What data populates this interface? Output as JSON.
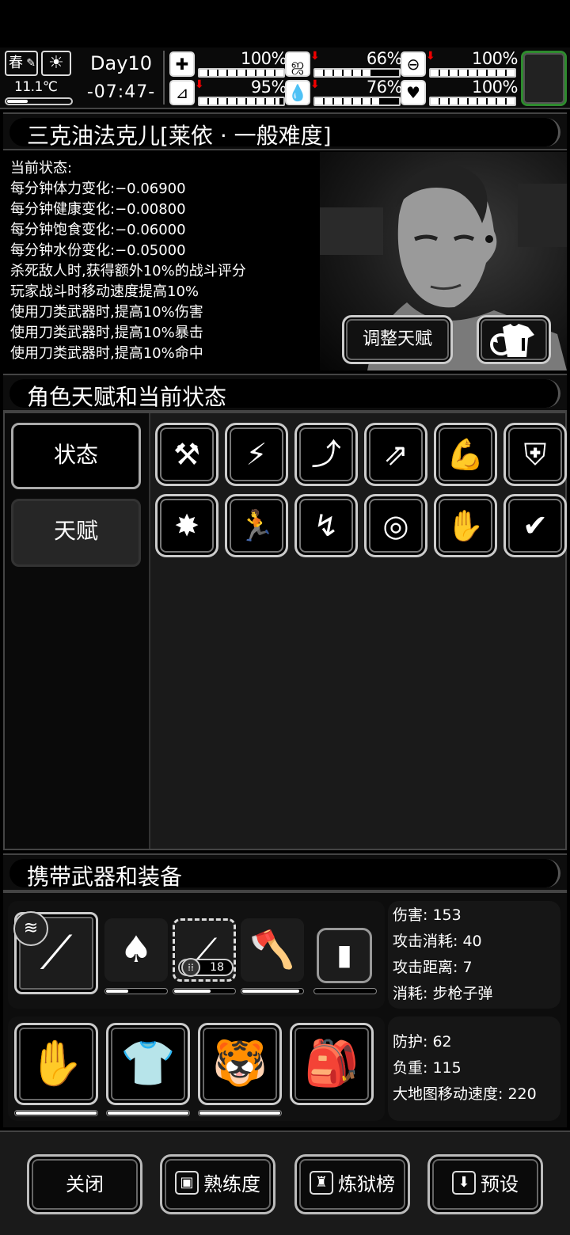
{
  "hud": {
    "season": "春",
    "weather_icon": "sun-icon",
    "temperature": "11.1℃",
    "day": "Day10",
    "time": "-07:47-",
    "stats": [
      {
        "name": "health",
        "icon": "first-aid-icon",
        "percent": "100%",
        "level": 1.0,
        "trend_down": false
      },
      {
        "name": "hunger",
        "icon": "stomach-icon",
        "percent": "66%",
        "level": 0.66,
        "trend_down": true
      },
      {
        "name": "medicine",
        "icon": "pill-icon",
        "percent": "100%",
        "level": 1.0,
        "trend_down": true
      },
      {
        "name": "stamina",
        "icon": "boot-icon",
        "percent": "95%",
        "level": 0.95,
        "trend_down": true
      },
      {
        "name": "water",
        "icon": "water-drop-icon",
        "percent": "76%",
        "level": 0.76,
        "trend_down": true
      },
      {
        "name": "mood",
        "icon": "heart-icon",
        "percent": "100%",
        "level": 1.0,
        "trend_down": false
      }
    ]
  },
  "character": {
    "title": "三克油法克儿[莱依 · 一般难度]",
    "status_lines": [
      "当前状态:",
      "每分钟体力变化:−0.06900",
      "每分钟健康变化:−0.00800",
      "每分钟饱食变化:−0.06000",
      "每分钟水份变化:−0.05000",
      "杀死敌人时,获得额外10%的战斗评分",
      "玩家战斗时移动速度提高10%",
      "使用刀类武器时,提高10%伤害",
      "使用刀类武器时,提高10%暴击",
      "使用刀类武器时,提高10%命中"
    ],
    "adjust_talent_label": "调整天赋"
  },
  "talents_section": {
    "title": "角色天赋和当前状态",
    "tabs": [
      {
        "label": "状态"
      },
      {
        "label": "天赋"
      }
    ],
    "icons": [
      "crossed-axes-icon",
      "knife-slash-icon",
      "machete-up-icon",
      "rifle-up-icon",
      "flexed-arm-icon",
      "shield-up-icon",
      "explosion-icon",
      "sprint-icon",
      "arm-break-icon",
      "target-up-icon",
      "grab-icon",
      "speed-check-icon"
    ]
  },
  "equipment": {
    "title": "携带武器和装备",
    "weapon_info": [
      "伤害: 153",
      "攻击消耗: 40",
      "攻击距离: 7",
      "消耗: 步枪子弹"
    ],
    "armor_info": [
      "防护: 62",
      "负重: 115",
      "大地图移动速度: 220"
    ],
    "ammo_count": "18",
    "weapons": [
      {
        "icon": "rifle-icon",
        "durability": null
      },
      {
        "icon": "shovel-icon",
        "durability": 0.35
      },
      {
        "icon": "sniper-rifle-icon",
        "durability": 0.6
      },
      {
        "icon": "axe-icon",
        "durability": 0.95
      },
      {
        "icon": "riot-shield-icon",
        "durability": 0.0
      }
    ],
    "armor": [
      {
        "icon": "gloves-icon",
        "durability": 0.98
      },
      {
        "icon": "shirt-icon",
        "durability": 0.98
      },
      {
        "icon": "tiger-hat-icon",
        "durability": 0.98
      },
      {
        "icon": "backpack-icon",
        "durability": null
      }
    ]
  },
  "bottom_buttons": {
    "close": "关闭",
    "proficiency": "熟练度",
    "ranking": "炼狱榜",
    "preset": "预设"
  }
}
